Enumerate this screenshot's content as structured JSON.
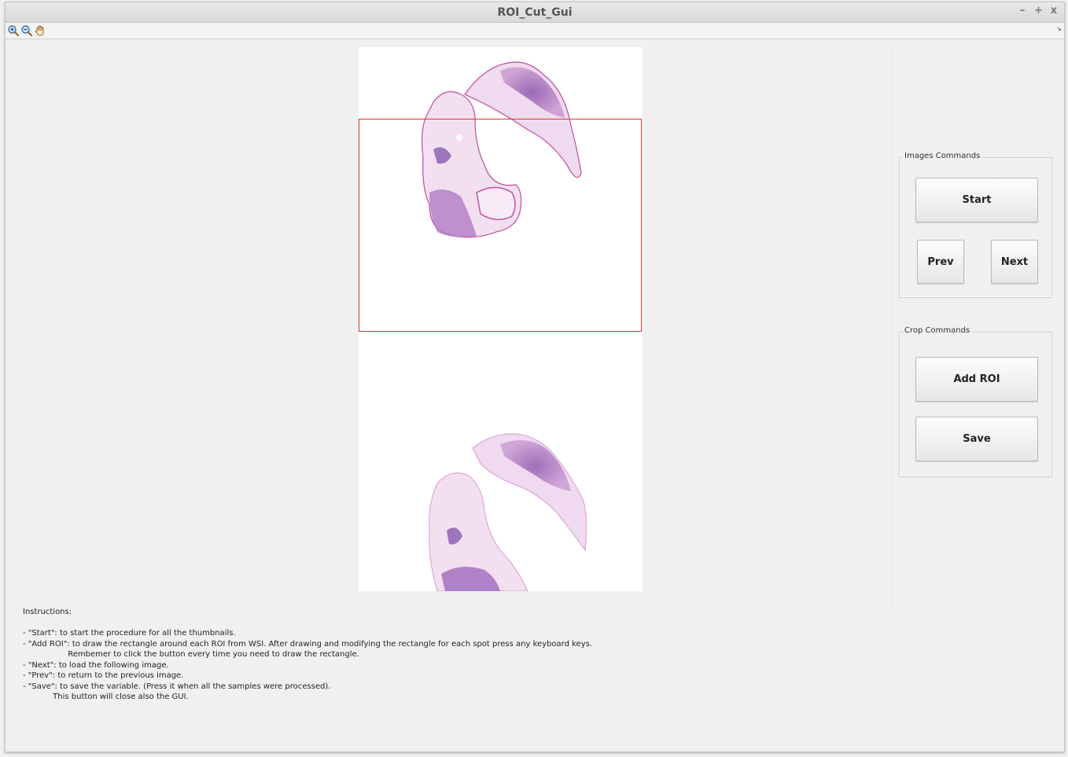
{
  "window": {
    "title": "ROI_Cut_Gui",
    "controls": {
      "minimize": "–",
      "maximize": "+",
      "close": "x"
    }
  },
  "toolbar": {
    "tools": [
      {
        "name": "zoom-in-icon",
        "interactable": true
      },
      {
        "name": "zoom-out-icon",
        "interactable": true
      },
      {
        "name": "pan-hand-icon",
        "interactable": true
      }
    ],
    "toggle_glyph": "↘"
  },
  "colors": {
    "roi_border": "#e23030",
    "tissue_pink": "#d9a3d4",
    "tissue_purple": "#9b5fb3",
    "tissue_edge": "#c24c9b"
  },
  "images_commands": {
    "title": "Images Commands",
    "start_label": "Start",
    "prev_label": "Prev",
    "next_label": "Next"
  },
  "crop_commands": {
    "title": "Crop Commands",
    "add_roi_label": "Add ROI",
    "save_label": "Save"
  },
  "instructions": {
    "heading": "Instructions:",
    "lines": [
      "- \"Start\": to start the procedure for all the thumbnails.",
      "- \"Add ROI\": to draw the rectangle around each ROI from WSI. After drawing and modifying the rectangle for each spot press any keyboard keys.",
      "                  Rembemer to click the button every time you need to draw the rectangle.",
      "- \"Next\": to load the following image.",
      "- \"Prev\": to return to the previous image.",
      "- \"Save\": to save the variable. (Press it when all the samples were processed).",
      "            This button will close also the GUI."
    ]
  }
}
